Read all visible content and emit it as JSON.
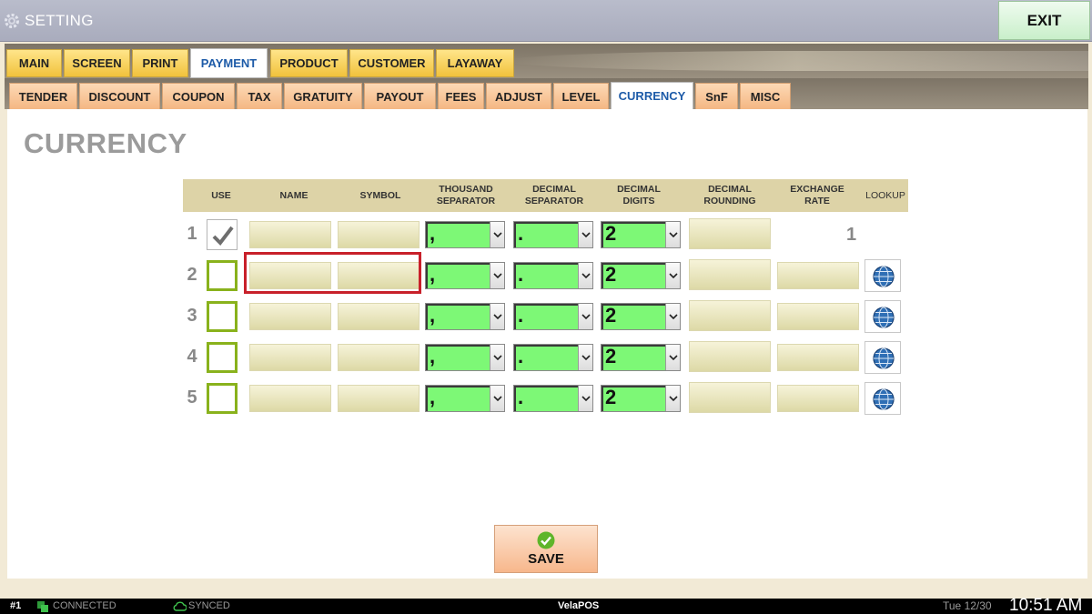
{
  "titlebar": {
    "title": "SETTING",
    "exit_label": "EXIT"
  },
  "tabs_main": [
    "MAIN",
    "SCREEN",
    "PRINT",
    "PAYMENT",
    "PRODUCT",
    "CUSTOMER",
    "LAYAWAY"
  ],
  "tabs_main_active": "PAYMENT",
  "tabs_sub": [
    "TENDER",
    "DISCOUNT",
    "COUPON",
    "TAX",
    "GRATUITY",
    "PAYOUT",
    "FEES",
    "ADJUST",
    "LEVEL",
    "CURRENCY",
    "SnF",
    "MISC"
  ],
  "tabs_sub_active": "CURRENCY",
  "page": {
    "title": "CURRENCY"
  },
  "table": {
    "headers": {
      "use": "USE",
      "name": "NAME",
      "symbol": "SYMBOL",
      "thousand_separator": "THOUSAND SEPARATOR",
      "decimal_separator": "DECIMAL SEPARATOR",
      "decimal_digits": "DECIMAL DIGITS",
      "decimal_rounding": "DECIMAL ROUNDING",
      "exchange_rate": "EXCHANGE RATE",
      "lookup": "LOOKUP"
    },
    "rows": [
      {
        "num": "1",
        "use": true,
        "name": "",
        "symbol": "",
        "thousand_sep": ",",
        "decimal_sep": ".",
        "decimal_digits": "2",
        "rounding": "",
        "exchange_rate": "1",
        "has_lookup": false
      },
      {
        "num": "2",
        "use": false,
        "name": "",
        "symbol": "",
        "thousand_sep": ",",
        "decimal_sep": ".",
        "decimal_digits": "2",
        "rounding": "",
        "exchange_rate": "",
        "has_lookup": true
      },
      {
        "num": "3",
        "use": false,
        "name": "",
        "symbol": "",
        "thousand_sep": ",",
        "decimal_sep": ".",
        "decimal_digits": "2",
        "rounding": "",
        "exchange_rate": "",
        "has_lookup": true
      },
      {
        "num": "4",
        "use": false,
        "name": "",
        "symbol": "",
        "thousand_sep": ",",
        "decimal_sep": ".",
        "decimal_digits": "2",
        "rounding": "",
        "exchange_rate": "",
        "has_lookup": true
      },
      {
        "num": "5",
        "use": false,
        "name": "",
        "symbol": "",
        "thousand_sep": ",",
        "decimal_sep": ".",
        "decimal_digits": "2",
        "rounding": "",
        "exchange_rate": "",
        "has_lookup": true
      }
    ]
  },
  "save_label": "SAVE",
  "statusbar": {
    "station": "#1",
    "connection": "CONNECTED",
    "sync": "SYNCED",
    "brand": "VelaPOS",
    "date": "Tue 12/30",
    "time": "10:51 AM"
  },
  "colors": {
    "tab_main": "#f1c23c",
    "tab_sub": "#f4b783",
    "active_tab_text": "#1d5ba8",
    "select_green": "#7df876",
    "checkbox_green": "#89b21c",
    "highlight_red": "#c8202a"
  }
}
